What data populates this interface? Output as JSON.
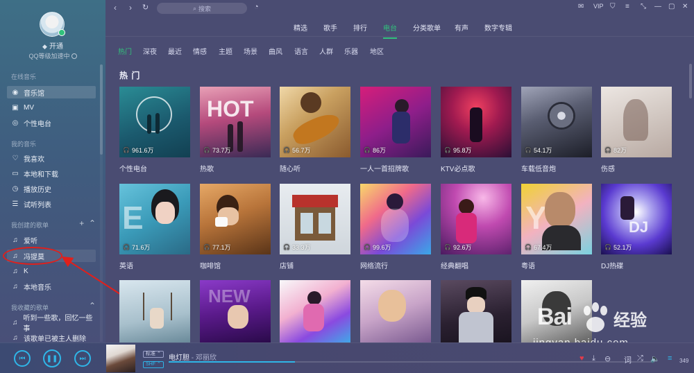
{
  "colors": {
    "accent": "#31c27c",
    "player_accent": "#2fb6e8",
    "highlight": "#e0201c"
  },
  "sidebar": {
    "open_label": "开通",
    "qq_level_label": "QQ等级加速中",
    "online_music_title": "在线音乐",
    "online_items": [
      {
        "label": "音乐馆",
        "icon": "music-hall-icon"
      },
      {
        "label": "MV",
        "icon": "mv-icon"
      },
      {
        "label": "个性电台",
        "icon": "radio-icon"
      }
    ],
    "my_music_title": "我的音乐",
    "my_items": [
      {
        "label": "我喜欢",
        "icon": "heart-icon"
      },
      {
        "label": "本地和下载",
        "icon": "computer-icon"
      },
      {
        "label": "播放历史",
        "icon": "clock-icon"
      },
      {
        "label": "试听列表",
        "icon": "list-icon"
      }
    ],
    "created_title": "我创建的歌单",
    "created_items": [
      {
        "label": "爱听",
        "icon": "note-icon"
      },
      {
        "label": "冯提莫",
        "icon": "note-icon"
      },
      {
        "label": "K",
        "icon": "note-icon"
      },
      {
        "label": "本地音乐",
        "icon": "note-icon"
      }
    ],
    "collected_title": "我收藏的歌单",
    "collected_items": [
      {
        "label": "听到一些歌，回忆一些事",
        "icon": "note-icon"
      },
      {
        "label": "该歌单已被主人删除",
        "icon": "note-icon"
      }
    ]
  },
  "topbar": {
    "search_placeholder": "搜索",
    "vip": "VIP"
  },
  "main_tabs": [
    "精选",
    "歌手",
    "排行",
    "电台",
    "分类歌单",
    "有声",
    "数字专辑"
  ],
  "active_main_tab": "电台",
  "sub_tabs": [
    "热门",
    "深夜",
    "最近",
    "情感",
    "主题",
    "场景",
    "曲风",
    "语言",
    "人群",
    "乐器",
    "地区"
  ],
  "active_sub_tab": "热门",
  "section_title": "热 门",
  "cards": [
    {
      "label": "个性电台",
      "plays": "961.6万"
    },
    {
      "label": "热歌",
      "plays": "73.7万"
    },
    {
      "label": "随心听",
      "plays": "56.7万"
    },
    {
      "label": "一人一首招牌歌",
      "plays": "86万"
    },
    {
      "label": "KTV必点歌",
      "plays": "95.8万"
    },
    {
      "label": "车载低音炮",
      "plays": "54.1万"
    },
    {
      "label": "伤感",
      "plays": "82万"
    },
    {
      "label": "英语",
      "plays": "71.6万"
    },
    {
      "label": "咖啡馆",
      "plays": "77.1万"
    },
    {
      "label": "店铺",
      "plays": "33.3万"
    },
    {
      "label": "网络流行",
      "plays": "99.6万"
    },
    {
      "label": "经典翻唱",
      "plays": "92.6万"
    },
    {
      "label": "粤语",
      "plays": "67.4万"
    },
    {
      "label": "DJ热碟",
      "plays": "52.1万"
    },
    {
      "label": "",
      "plays": ""
    },
    {
      "label": "",
      "plays": ""
    },
    {
      "label": "",
      "plays": ""
    },
    {
      "label": "",
      "plays": ""
    },
    {
      "label": "",
      "plays": ""
    },
    {
      "label": "",
      "plays": ""
    }
  ],
  "card_overlay_text": {
    "hot": "HOT",
    "new": "NEW",
    "dj": "DJ"
  },
  "player": {
    "quality_tag": "标准",
    "sound_tag": "SHF",
    "song_title": "电灯胆",
    "separator": " - ",
    "artist": "邓丽欣",
    "progress": 0.26,
    "playlist_count": "349"
  },
  "watermark": {
    "brand": "Bai",
    "brand2": "经验",
    "url": "jingyan.baidu.com"
  }
}
